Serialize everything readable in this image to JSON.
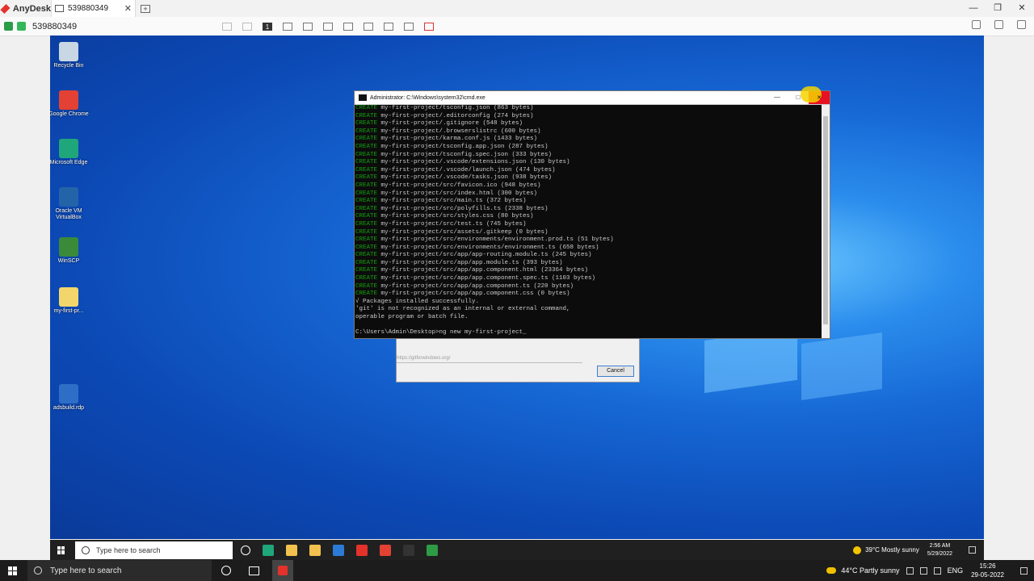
{
  "anydesk": {
    "app_name": "AnyDesk",
    "tab_title": "539880349",
    "tab_close": "✕",
    "new_tab": "+",
    "address_id": "539880349",
    "toolbar_display_num": "1",
    "win_controls": [
      "—",
      "❐",
      "✕"
    ]
  },
  "desktop_icons": [
    {
      "label": "Recycle Bin",
      "color": "#c9d6e3"
    },
    {
      "label": "Google Chrome",
      "color": "#e34133"
    },
    {
      "label": "Microsoft Edge",
      "color": "#1fa67a"
    },
    {
      "label": "Oracle VM VirtualBox",
      "color": "#2364a8"
    },
    {
      "label": "WinSCP",
      "color": "#3a8a3a"
    },
    {
      "label": "my-first-pr...",
      "color": "#f3d66b"
    },
    {
      "label": "adsbuild.rdp",
      "color": "#2f6ec7"
    }
  ],
  "dialog": {
    "url": "https://gitforwindows.org/",
    "cancel_label": "Cancel"
  },
  "cmd": {
    "title": "Administrator: C:\\Windows\\system32\\cmd.exe",
    "controls": [
      "—",
      "□",
      "✕"
    ],
    "create_lines": [
      {
        "kw": "CREATE",
        "text": " my-first-project/tsconfig.json (863 bytes)"
      },
      {
        "kw": "CREATE",
        "text": " my-first-project/.editorconfig (274 bytes)"
      },
      {
        "kw": "CREATE",
        "text": " my-first-project/.gitignore (548 bytes)"
      },
      {
        "kw": "CREATE",
        "text": " my-first-project/.browserslistrc (600 bytes)"
      },
      {
        "kw": "CREATE",
        "text": " my-first-project/karma.conf.js (1433 bytes)"
      },
      {
        "kw": "CREATE",
        "text": " my-first-project/tsconfig.app.json (287 bytes)"
      },
      {
        "kw": "CREATE",
        "text": " my-first-project/tsconfig.spec.json (333 bytes)"
      },
      {
        "kw": "CREATE",
        "text": " my-first-project/.vscode/extensions.json (130 bytes)"
      },
      {
        "kw": "CREATE",
        "text": " my-first-project/.vscode/launch.json (474 bytes)"
      },
      {
        "kw": "CREATE",
        "text": " my-first-project/.vscode/tasks.json (938 bytes)"
      },
      {
        "kw": "CREATE",
        "text": " my-first-project/src/favicon.ico (948 bytes)"
      },
      {
        "kw": "CREATE",
        "text": " my-first-project/src/index.html (300 bytes)"
      },
      {
        "kw": "CREATE",
        "text": " my-first-project/src/main.ts (372 bytes)"
      },
      {
        "kw": "CREATE",
        "text": " my-first-project/src/polyfills.ts (2338 bytes)"
      },
      {
        "kw": "CREATE",
        "text": " my-first-project/src/styles.css (80 bytes)"
      },
      {
        "kw": "CREATE",
        "text": " my-first-project/src/test.ts (745 bytes)"
      },
      {
        "kw": "CREATE",
        "text": " my-first-project/src/assets/.gitkeep (0 bytes)"
      },
      {
        "kw": "CREATE",
        "text": " my-first-project/src/environments/environment.prod.ts (51 bytes)"
      },
      {
        "kw": "CREATE",
        "text": " my-first-project/src/environments/environment.ts (658 bytes)"
      },
      {
        "kw": "CREATE",
        "text": " my-first-project/src/app/app-routing.module.ts (245 bytes)"
      },
      {
        "kw": "CREATE",
        "text": " my-first-project/src/app/app.module.ts (393 bytes)"
      },
      {
        "kw": "CREATE",
        "text": " my-first-project/src/app/app.component.html (23364 bytes)"
      },
      {
        "kw": "CREATE",
        "text": " my-first-project/src/app/app.component.spec.ts (1103 bytes)"
      },
      {
        "kw": "CREATE",
        "text": " my-first-project/src/app/app.component.ts (220 bytes)"
      },
      {
        "kw": "CREATE",
        "text": " my-first-project/src/app/app.component.css (0 bytes)"
      }
    ],
    "status_lines": [
      "√ Packages installed successfully.",
      "'git' is not recognized as an internal or external command,",
      "operable program or batch file."
    ],
    "prompt": "C:\\Users\\Admin\\Desktop>ng new my-first-project_"
  },
  "remote_taskbar": {
    "search_placeholder": "Type here to search",
    "apps": [
      "#ffffff",
      "#1fa67a",
      "#f2c14e",
      "#f2c14e",
      "#2b7bd6",
      "#e4322b",
      "#e34133",
      "#333333",
      "#2e9b45"
    ],
    "weather": "39°C  Mostly sunny",
    "time": "2:56 AM",
    "date": "5/29/2022"
  },
  "local_taskbar": {
    "search_placeholder": "Type here to search",
    "weather": "44°C  Partly sunny",
    "lang": "ENG",
    "time": "15:26",
    "date": "29-05-2022"
  }
}
